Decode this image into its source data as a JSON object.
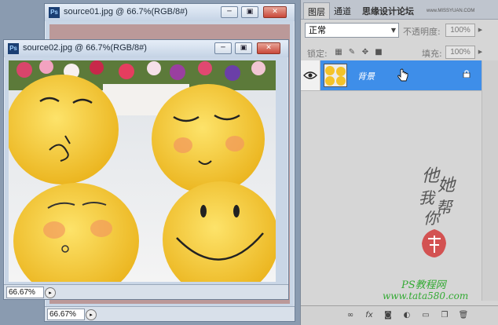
{
  "window_back": {
    "title": "source01.jpg @ 66.7%(RGB/8#)",
    "zoom": "66.67%"
  },
  "window_front": {
    "title": "source02.jpg @ 66.7%(RGB/8#)",
    "zoom": "66.67%"
  },
  "window_buttons": {
    "minimize": "─",
    "restore": "▣",
    "close": "✕"
  },
  "layers_panel": {
    "tabs": [
      "图层",
      "通道",
      "思缘设计论坛"
    ],
    "website": "www.MISSYUAN.COM",
    "blend_mode": "正常",
    "opacity_label": "不透明度:",
    "opacity_value": "100%",
    "lock_label": "锁定:",
    "fill_label": "填充:",
    "fill_value": "100%",
    "layer_name": "背景",
    "calligraphy": [
      "他",
      "她",
      "我",
      "帮",
      "你"
    ],
    "watermark_line1": "PS教程网",
    "watermark_line2": "www.tata580.com"
  },
  "colors": {
    "selection": "#3e8ee9",
    "plush": "#f6c92b"
  }
}
